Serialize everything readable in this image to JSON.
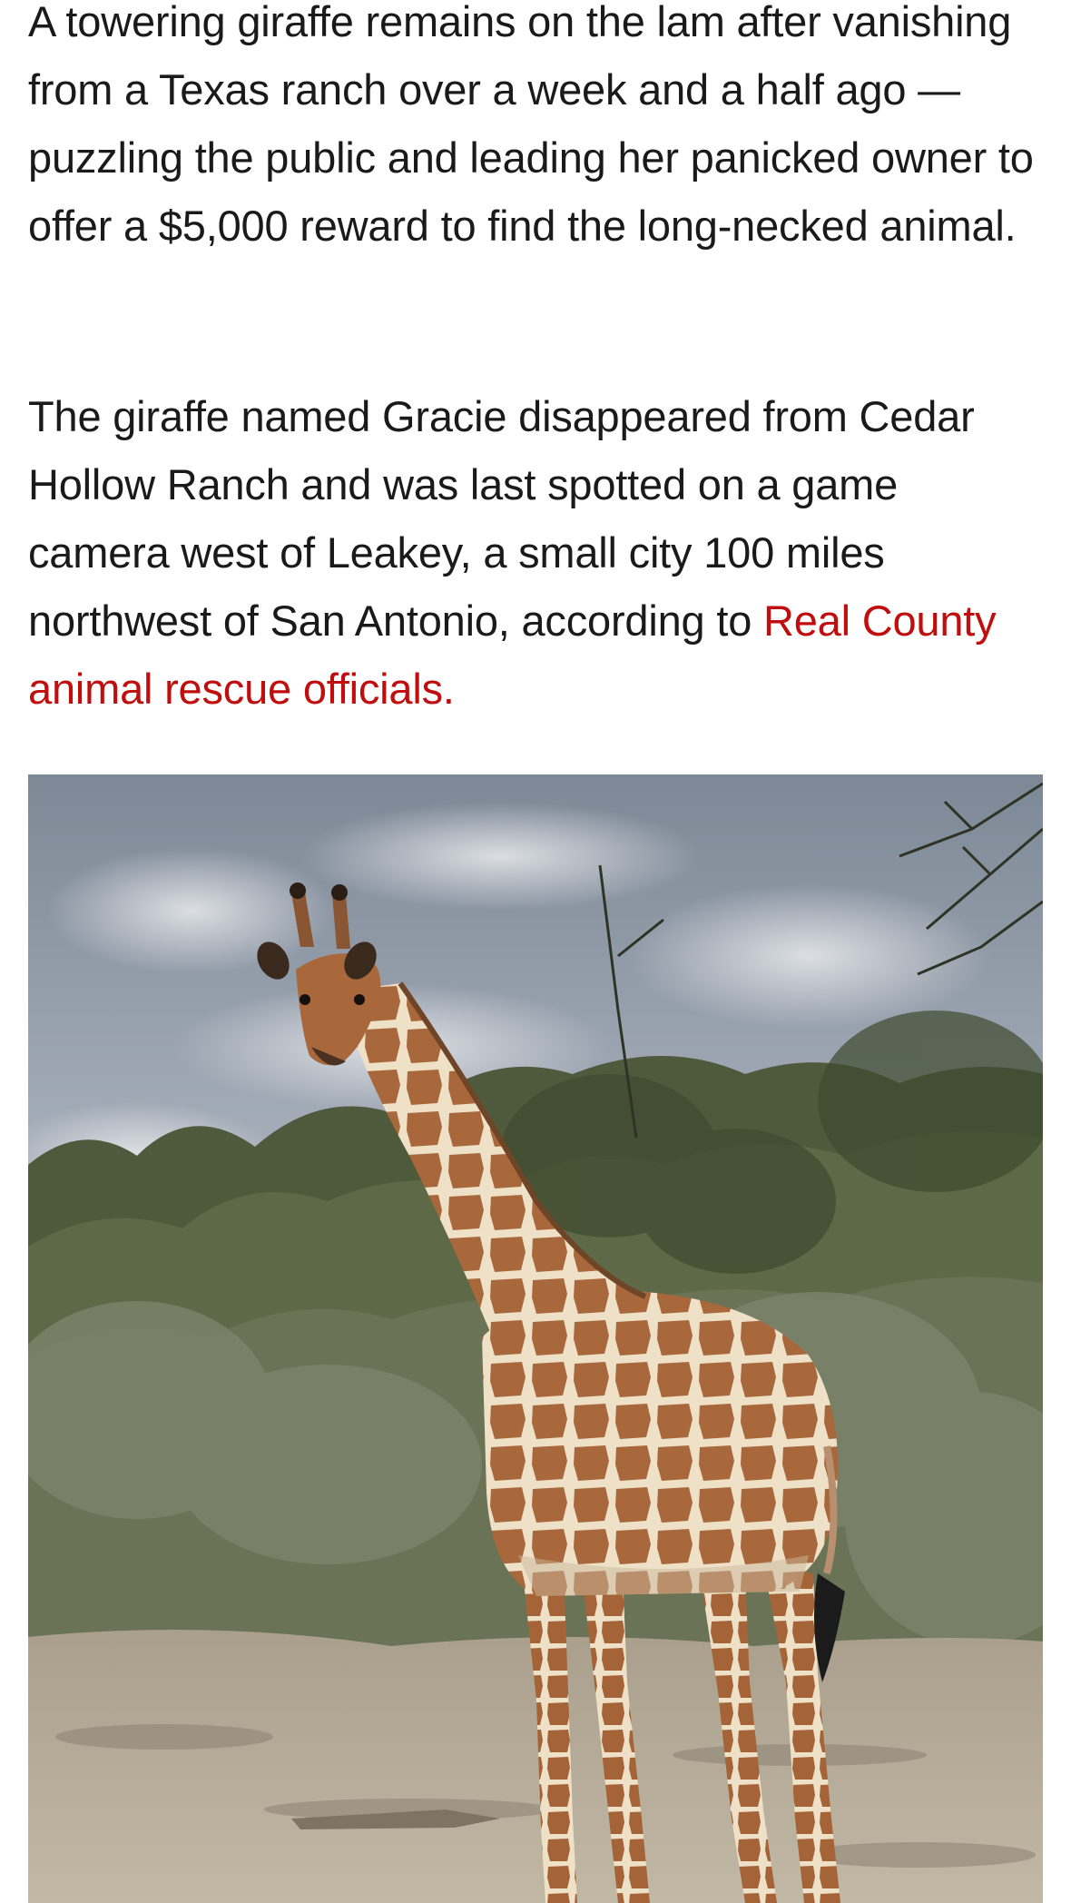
{
  "article": {
    "paragraph_1": "A towering giraffe remains on the lam after vanishing from a Texas ranch over a week and a half ago — puzzling the public and leading her panicked owner to offer a $5,000 reward to find the long-necked animal.",
    "paragraph_2_text": "The giraffe named Gracie disappeared from Cedar Hollow Ranch and was last spotted on a game camera west of Leakey, a small city 100 miles northwest of San Antonio, according to ",
    "paragraph_2_link": "Real County animal rescue officials."
  },
  "image": {
    "subject": "giraffe-photo",
    "colors": {
      "sky": "#8f9aa6",
      "brush": "#55603f",
      "ground": "#b8ad9c",
      "giraffe_patch": "#a8683c",
      "giraffe_line": "#efe1c8",
      "link": "#c00d0d"
    }
  }
}
